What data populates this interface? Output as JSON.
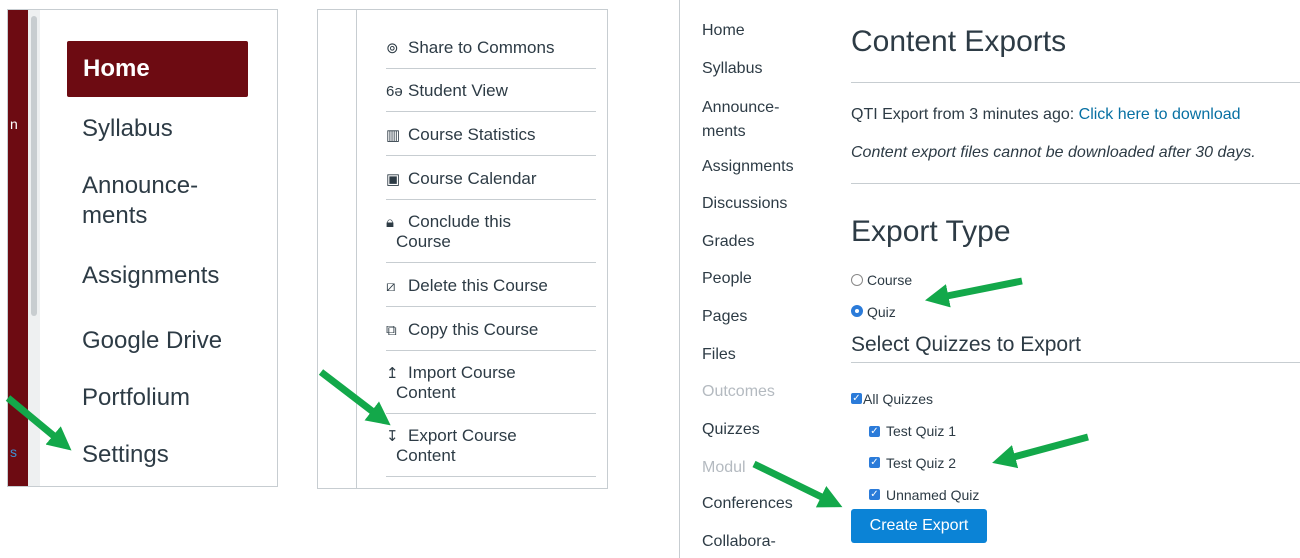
{
  "course_nav_panel": {
    "items": [
      "Home",
      "Syllabus",
      "Announce-",
      "ments",
      "Assignments",
      "Google Drive",
      "Portfolium",
      "Settings"
    ],
    "partial_text": [
      "n",
      "s"
    ]
  },
  "sidebar_panel": {
    "items": [
      {
        "icon": "share-icon",
        "glyph": "⊚",
        "label_lines": [
          "Share to Commons"
        ]
      },
      {
        "icon": "student-view-icon",
        "glyph": "6ə",
        "label_lines": [
          "Student View"
        ]
      },
      {
        "icon": "course-statistics-icon",
        "glyph": "▥",
        "label_lines": [
          "Course Statistics"
        ]
      },
      {
        "icon": "calendar-icon",
        "glyph": "▣",
        "label_lines": [
          "Course Calendar"
        ]
      },
      {
        "icon": "lock-icon",
        "glyph": "🔒︎",
        "label_lines": [
          "Conclude this",
          "Course"
        ]
      },
      {
        "icon": "trash-icon",
        "glyph": "⧄",
        "label_lines": [
          "Delete this Course"
        ]
      },
      {
        "icon": "copy-icon",
        "glyph": "⧉",
        "label_lines": [
          "Copy this Course"
        ]
      },
      {
        "icon": "import-icon",
        "glyph": "↥",
        "label_lines": [
          "Import Course",
          "Content"
        ]
      },
      {
        "icon": "export-icon",
        "glyph": "↧",
        "label_lines": [
          "Export Course",
          "Content"
        ]
      }
    ]
  },
  "export_panel": {
    "nav": [
      "Home",
      "Syllabus",
      "Announce-",
      "ments",
      "Assignments",
      "Discussions",
      "Grades",
      "People",
      "Pages",
      "Files",
      "Outcomes",
      "Quizzes",
      "Modul",
      "Conferences",
      "Collabora-"
    ],
    "title": "Content Exports",
    "export_notice_prefix": "QTI Export from 3 minutes ago: ",
    "export_link": "Click here to download",
    "export_expiry_note": "Content export files cannot be downloaded after 30 days.",
    "export_type_heading": "Export Type",
    "radio_course": "Course",
    "radio_quiz": "Quiz",
    "select_quizzes_heading": "Select Quizzes to Export",
    "checkbox_all": "All Quizzes",
    "quizzes": [
      "Test Quiz 1",
      "Test Quiz 2",
      "Unnamed Quiz"
    ],
    "button": "Create Export"
  },
  "colors": {
    "maroon": "#6d0b12",
    "link_blue": "#0770a3",
    "button_blue": "#0b83d6",
    "arrow_green": "#13a84a"
  }
}
